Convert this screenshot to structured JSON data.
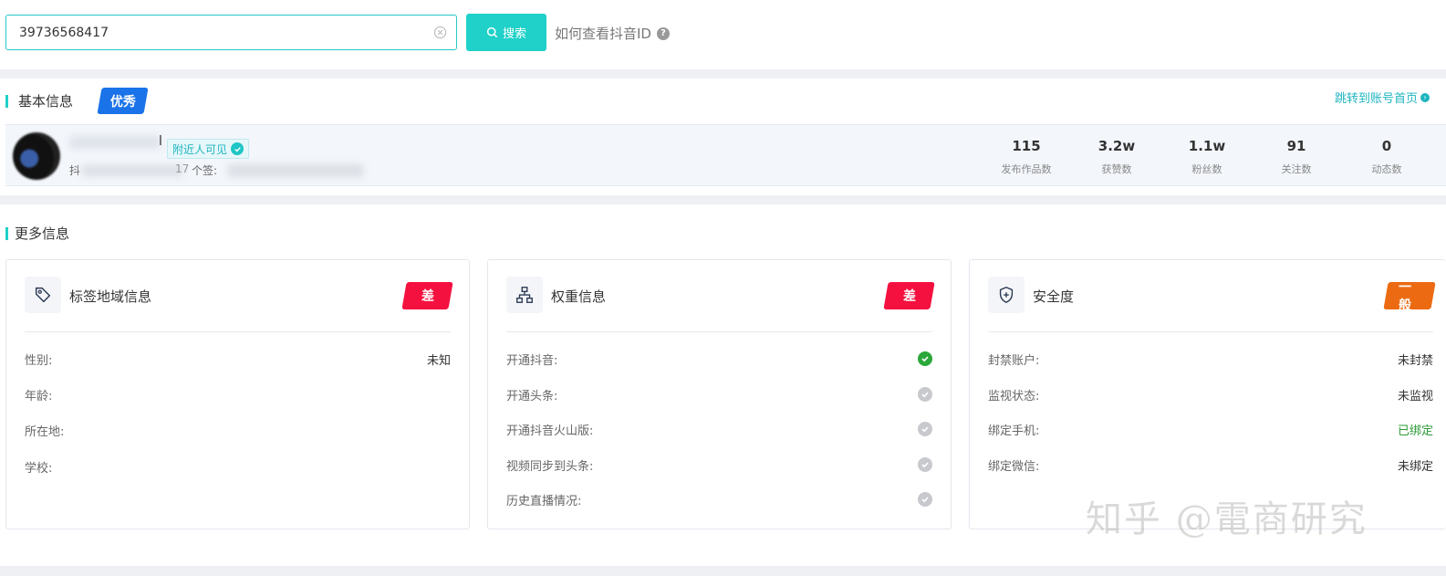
{
  "search": {
    "value": "39736568417",
    "button_label": "搜索",
    "howto_label": "如何查看抖音ID",
    "howto_icon": "?"
  },
  "basic": {
    "section_title": "基本信息",
    "level_badge": "优秀",
    "jump_label": "跳转到账号首页",
    "name_tail": "l",
    "nearby_badge": "附近人可见",
    "douyin_id_label": "抖",
    "id_tail": "17",
    "sign_label": "个签:",
    "stats": [
      {
        "value": "115",
        "label": "发布作品数"
      },
      {
        "value": "3.2w",
        "label": "获赞数"
      },
      {
        "value": "1.1w",
        "label": "粉丝数"
      },
      {
        "value": "91",
        "label": "关注数"
      },
      {
        "value": "0",
        "label": "动态数"
      }
    ]
  },
  "more": {
    "section_title": "更多信息",
    "cards": [
      {
        "title": "标签地域信息",
        "icon": "tag-icon",
        "grade": "差",
        "rows": [
          {
            "label": "性别:",
            "value": "未知"
          },
          {
            "label": "年龄:",
            "value": ""
          },
          {
            "label": "所在地:",
            "value": ""
          },
          {
            "label": "学校:",
            "value": ""
          }
        ]
      },
      {
        "title": "权重信息",
        "icon": "sitemap-icon",
        "grade": "差",
        "rows": [
          {
            "label": "开通抖音:",
            "status": "on"
          },
          {
            "label": "开通头条:",
            "status": "off"
          },
          {
            "label": "开通抖音火山版:",
            "status": "off"
          },
          {
            "label": "视频同步到头条:",
            "status": "off"
          },
          {
            "label": "历史直播情况:",
            "status": "off"
          }
        ]
      },
      {
        "title": "安全度",
        "icon": "shield-icon",
        "grade": "一般",
        "rows": [
          {
            "label": "封禁账户:",
            "value": "未封禁"
          },
          {
            "label": "监视状态:",
            "value": "未监视"
          },
          {
            "label": "绑定手机:",
            "value": "已绑定"
          },
          {
            "label": "绑定微信:",
            "value": "未绑定"
          }
        ]
      }
    ]
  },
  "watermark": "知乎 @電商研究",
  "colors": {
    "accent": "#1fd1c8",
    "badge_blue": "#1a73e8",
    "grade_bad": "#f5113f",
    "grade_mid": "#ec6a12",
    "status_on": "#2aa83a",
    "status_off": "#c8c9cd"
  }
}
